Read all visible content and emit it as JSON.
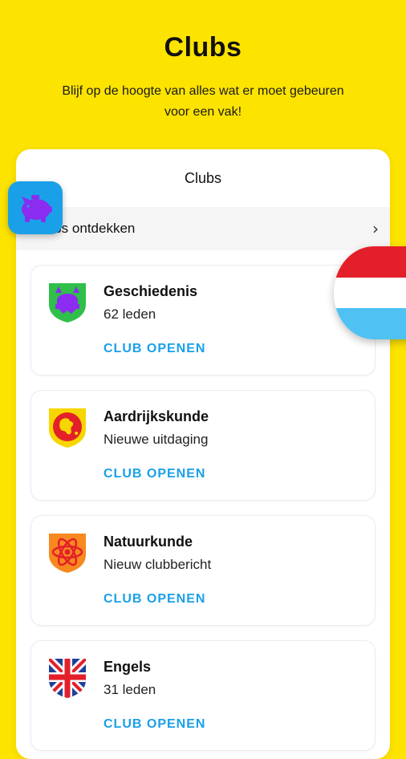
{
  "header": {
    "title": "Clubs",
    "subtitle": "Blijf op de hoogte van alles wat er moet gebeuren voor een vak!"
  },
  "sheet": {
    "title": "Clubs",
    "discover_label": "lubs ontdekken",
    "discover_icon": "chevron-right-icon"
  },
  "clubs": [
    {
      "name": "Geschiedenis",
      "status": "62 leden",
      "action": "CLUB OPENEN",
      "icon": "viking-helmet-icon",
      "color": "#2fbf4a"
    },
    {
      "name": "Aardrijkskunde",
      "status": "Nieuwe uitdaging",
      "action": "CLUB OPENEN",
      "icon": "globe-icon",
      "color": "#f7d600"
    },
    {
      "name": "Natuurkunde",
      "status": "Nieuw clubbericht",
      "action": "CLUB OPENEN",
      "icon": "atom-icon",
      "color": "#f7891f"
    },
    {
      "name": "Engels",
      "status": "31 leden",
      "action": "CLUB OPENEN",
      "icon": "union-jack-icon",
      "color": "#1e3f9a"
    }
  ],
  "colors": {
    "background": "#fde300",
    "accent": "#1aa0e8",
    "piggy": "#8b2cf0"
  },
  "floating": {
    "left_icon": "piggy-bank-icon",
    "right_icon": "luxembourg-flag-icon"
  }
}
